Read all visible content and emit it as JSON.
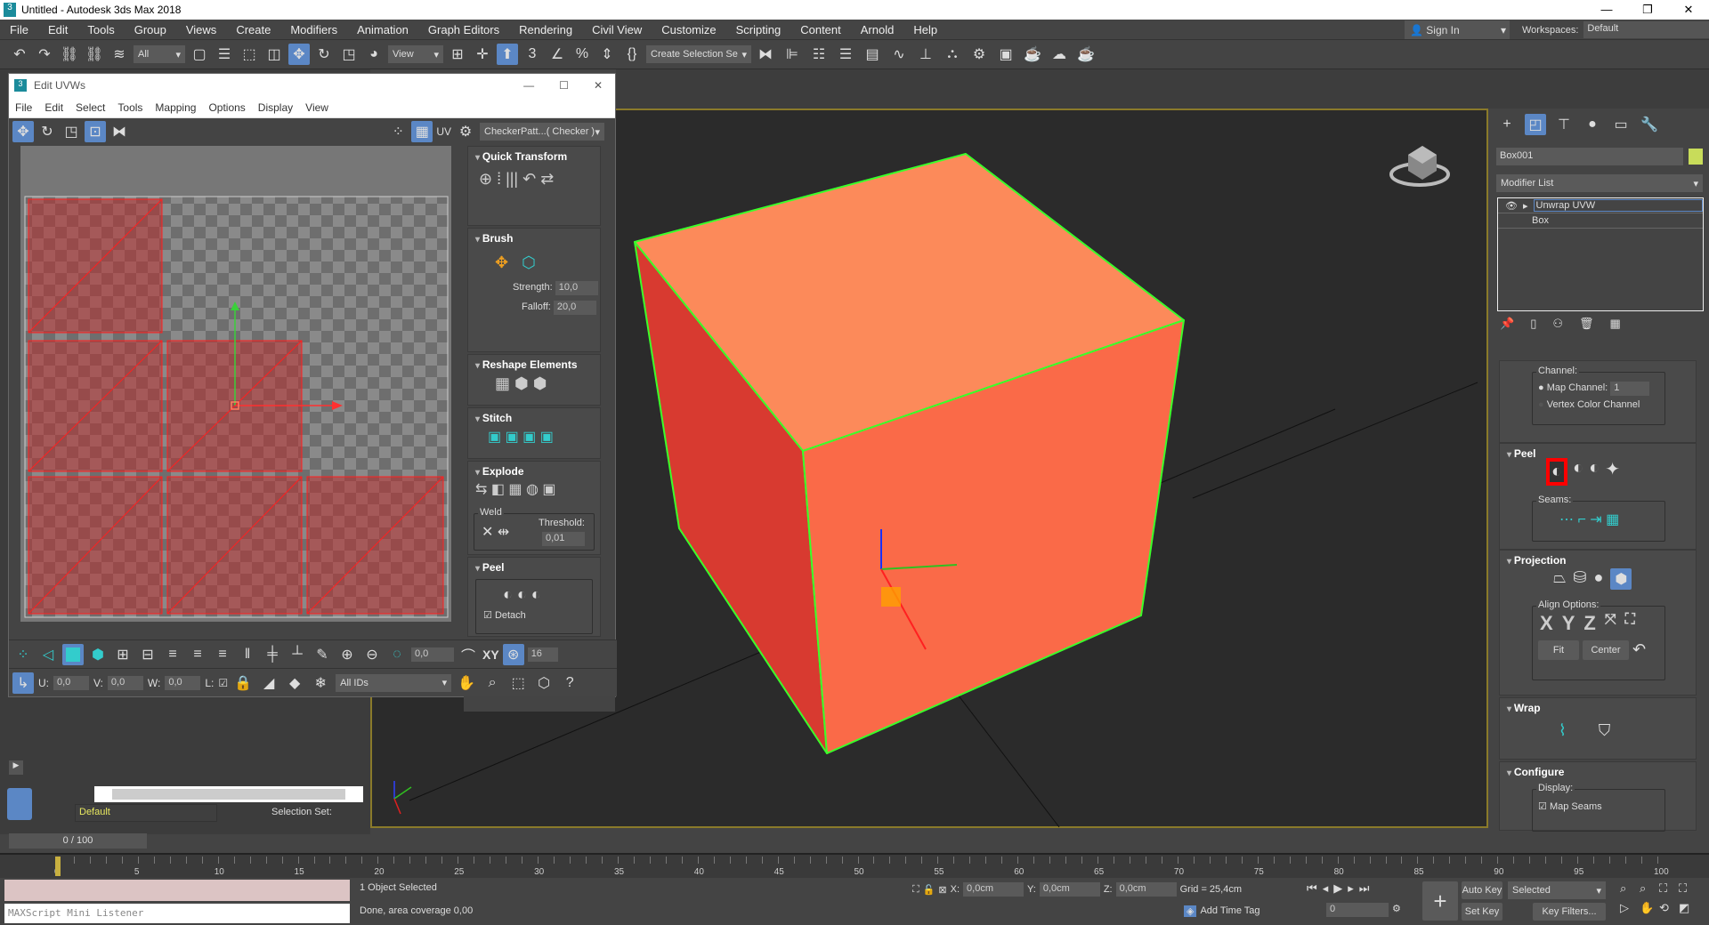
{
  "app": {
    "title": "Untitled - Autodesk 3ds Max 2018",
    "icon": "3ds-max-logo",
    "min": "—",
    "max": "❐",
    "close": "✕"
  },
  "menu": [
    "File",
    "Edit",
    "Tools",
    "Group",
    "Views",
    "Create",
    "Modifiers",
    "Animation",
    "Graph Editors",
    "Rendering",
    "Civil View",
    "Customize",
    "Scripting",
    "Content",
    "Arnold",
    "Help"
  ],
  "signin": {
    "label": "Sign In"
  },
  "workspaces": {
    "label": "Workspaces:",
    "value": "Default"
  },
  "toolbar": {
    "icons_a": [
      "undo-icon",
      "redo-icon",
      "link-icon",
      "unlink-icon",
      "bind-space-warp-icon"
    ],
    "filter": "All",
    "icons_b": [
      "select-object-icon",
      "select-by-name-icon",
      "rect-selection-icon",
      "window-crossing-icon",
      "move-icon",
      "rotate-icon",
      "scale-icon",
      "placement-icon"
    ],
    "refcoord": "View",
    "icons_c": [
      "pivot-icon",
      "manipulate-icon",
      "keyboard-shortcut-icon",
      "snap-3d-icon",
      "angle-snap-icon",
      "percent-snap-icon",
      "spinner-snap-icon",
      "edit-named-sets-icon"
    ],
    "selset": "Create Selection Se",
    "icons_d": [
      "mirror-icon",
      "align-icon",
      "scene-explorer-icon",
      "layer-explorer-icon",
      "ribbon-icon",
      "curve-editor-icon",
      "schematic-icon",
      "material-editor-icon",
      "render-setup-icon",
      "rendered-frame-icon",
      "render-icon",
      "render-cloud-icon",
      "render-iterative-icon"
    ]
  },
  "uv": {
    "title": "Edit UVWs",
    "min": "—",
    "max": "☐",
    "close": "✕",
    "menu": [
      "File",
      "Edit",
      "Select",
      "Tools",
      "Mapping",
      "Options",
      "Display",
      "View"
    ],
    "toolbar_icons": [
      "move-icon",
      "rotate-icon",
      "scale-icon",
      "freeform-icon",
      "mirror-icon"
    ],
    "right_icons": [
      "show-map-icon",
      "checker-display-icon"
    ],
    "uv_label": "UV",
    "texture": "CheckerPatt...( Checker )",
    "panel": {
      "quick_transform": "Quick Transform",
      "brush": "Brush",
      "strength_label": "Strength:",
      "strength": "10,0",
      "falloff_label": "Falloff:",
      "falloff": "20,0",
      "reshape": "Reshape Elements",
      "stitch": "Stitch",
      "explode": "Explode",
      "weld": "Weld",
      "threshold_label": "Threshold:",
      "threshold": "0,01",
      "peel": "Peel",
      "detach": "Detach",
      "detach_checked": true
    },
    "bottom1": {
      "soft_sel": "0,0",
      "grid_snap": "16",
      "xy": "XY"
    },
    "bottom2": {
      "u_label": "U:",
      "u": "0,0",
      "v_label": "V:",
      "v": "0,0",
      "w_label": "W:",
      "w": "0,0",
      "l_label": "L:",
      "ids": "All IDs"
    },
    "colors": {
      "face_fill": "#c0282880",
      "seam": "#ff2020"
    }
  },
  "viewport": {
    "colors": {
      "cube_top": "#fc8a5a",
      "cube_left": "#d83a30",
      "cube_front": "#fa6a48",
      "edge": "#3bff2a"
    }
  },
  "command_panel": {
    "tabs": [
      "create-icon",
      "modify-icon",
      "hierarchy-icon",
      "motion-icon",
      "display-icon",
      "utilities-icon"
    ],
    "object_name": "Box001",
    "object_color": "#c8dc5a",
    "modifier_list": "Modifier List",
    "stack": [
      "Unwrap UVW",
      "Box"
    ],
    "channel": {
      "label": "Channel:",
      "map_channel": "Map Channel:",
      "map_value": "1",
      "vertex": "Vertex Color Channel"
    },
    "peel": {
      "title": "Peel",
      "seams": "Seams:"
    },
    "projection": {
      "title": "Projection",
      "align": "Align Options:",
      "x": "X",
      "y": "Y",
      "z": "Z",
      "fit": "Fit",
      "center": "Center"
    },
    "wrap": {
      "title": "Wrap"
    },
    "configure": {
      "title": "Configure",
      "display": "Display:",
      "map_seams": "Map Seams"
    }
  },
  "left": {
    "layer": "Default",
    "selection_set": "Selection Set:"
  },
  "time": {
    "slider": "0 / 100",
    "ticks": [
      "0",
      "5",
      "10",
      "15",
      "20",
      "25",
      "30",
      "35",
      "40",
      "45",
      "50",
      "55",
      "60",
      "65",
      "70",
      "75",
      "80",
      "85",
      "90",
      "95",
      "100"
    ]
  },
  "status": {
    "selected": "1 Object Selected",
    "prompt": "Done, area coverage 0,00",
    "listener": "MAXScript Mini Listener",
    "x_label": "X:",
    "x": "0,0cm",
    "y_label": "Y:",
    "y": "0,0cm",
    "z_label": "Z:",
    "z": "0,0cm",
    "grid": "Grid = 25,4cm",
    "add_time_tag": "Add Time Tag",
    "auto_key": "Auto Key",
    "set_key": "Set Key",
    "key_mode": "Selected",
    "key_filters": "Key Filters...",
    "frame": "0"
  }
}
